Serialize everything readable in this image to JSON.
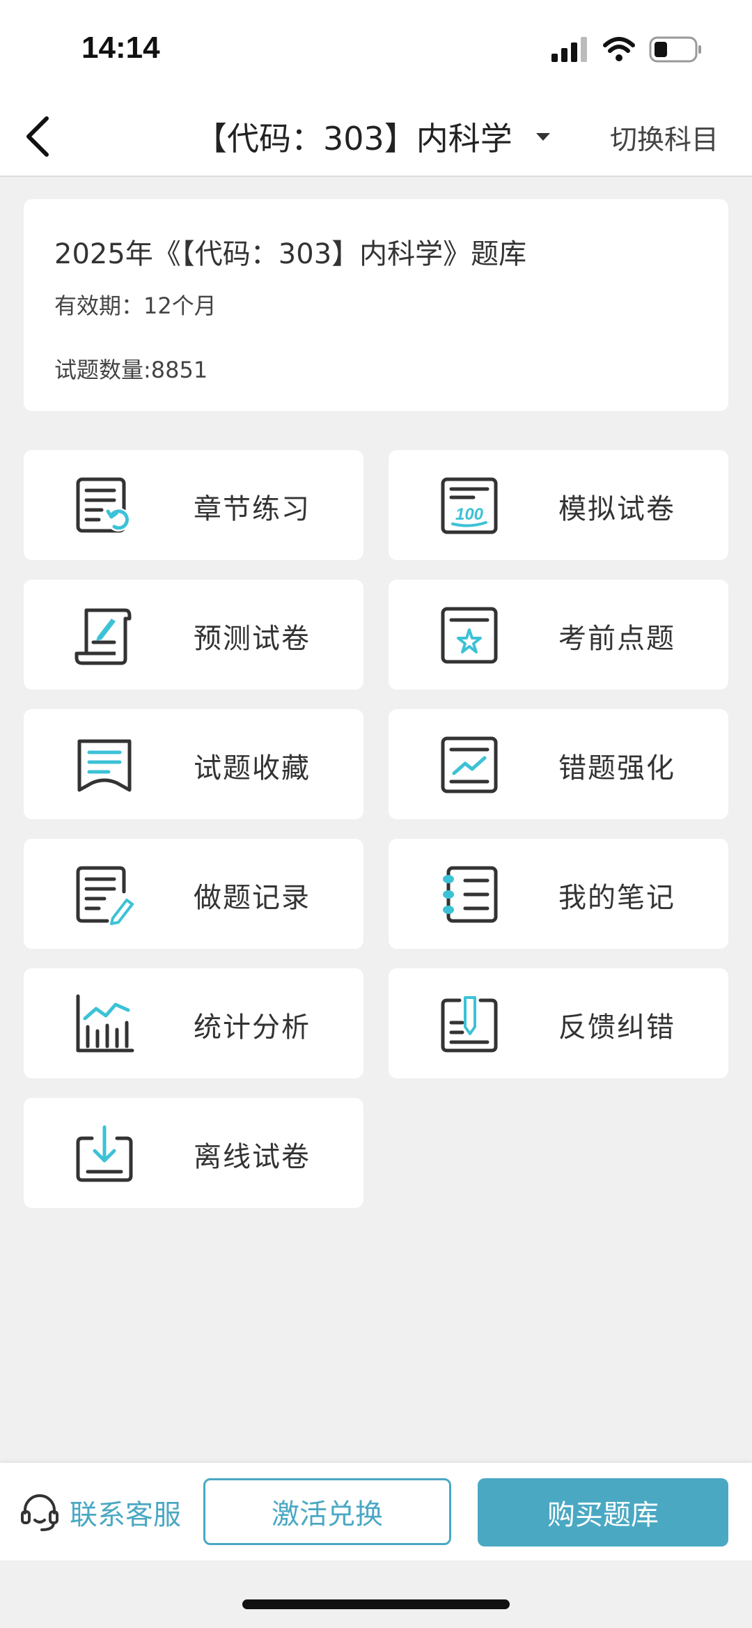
{
  "status_bar": {
    "time": "14:14"
  },
  "nav": {
    "title": "【代码：303】内科学",
    "switch_label": "切换科目"
  },
  "info": {
    "title": "2025年《【代码：303】内科学》题库",
    "validity": "有效期：12个月",
    "count": "试题数量:8851"
  },
  "tiles": [
    {
      "label": "章节练习",
      "icon": "chapter-practice-icon"
    },
    {
      "label": "模拟试卷",
      "icon": "mock-exam-icon"
    },
    {
      "label": "预测试卷",
      "icon": "prediction-exam-icon"
    },
    {
      "label": "考前点题",
      "icon": "pre-exam-star-icon"
    },
    {
      "label": "试题收藏",
      "icon": "favorites-icon"
    },
    {
      "label": "错题强化",
      "icon": "wrong-question-icon"
    },
    {
      "label": "做题记录",
      "icon": "record-icon"
    },
    {
      "label": "我的笔记",
      "icon": "notes-icon"
    },
    {
      "label": "统计分析",
      "icon": "statistics-icon"
    },
    {
      "label": "反馈纠错",
      "icon": "feedback-icon"
    },
    {
      "label": "离线试卷",
      "icon": "offline-download-icon"
    }
  ],
  "bottom": {
    "contact_label": "联系客服",
    "activate_label": "激活兑换",
    "buy_label": "购买题库"
  },
  "colors": {
    "accent": "#4aa8c3",
    "icon_accent": "#3cc2d6",
    "background": "#f0f0f0"
  }
}
